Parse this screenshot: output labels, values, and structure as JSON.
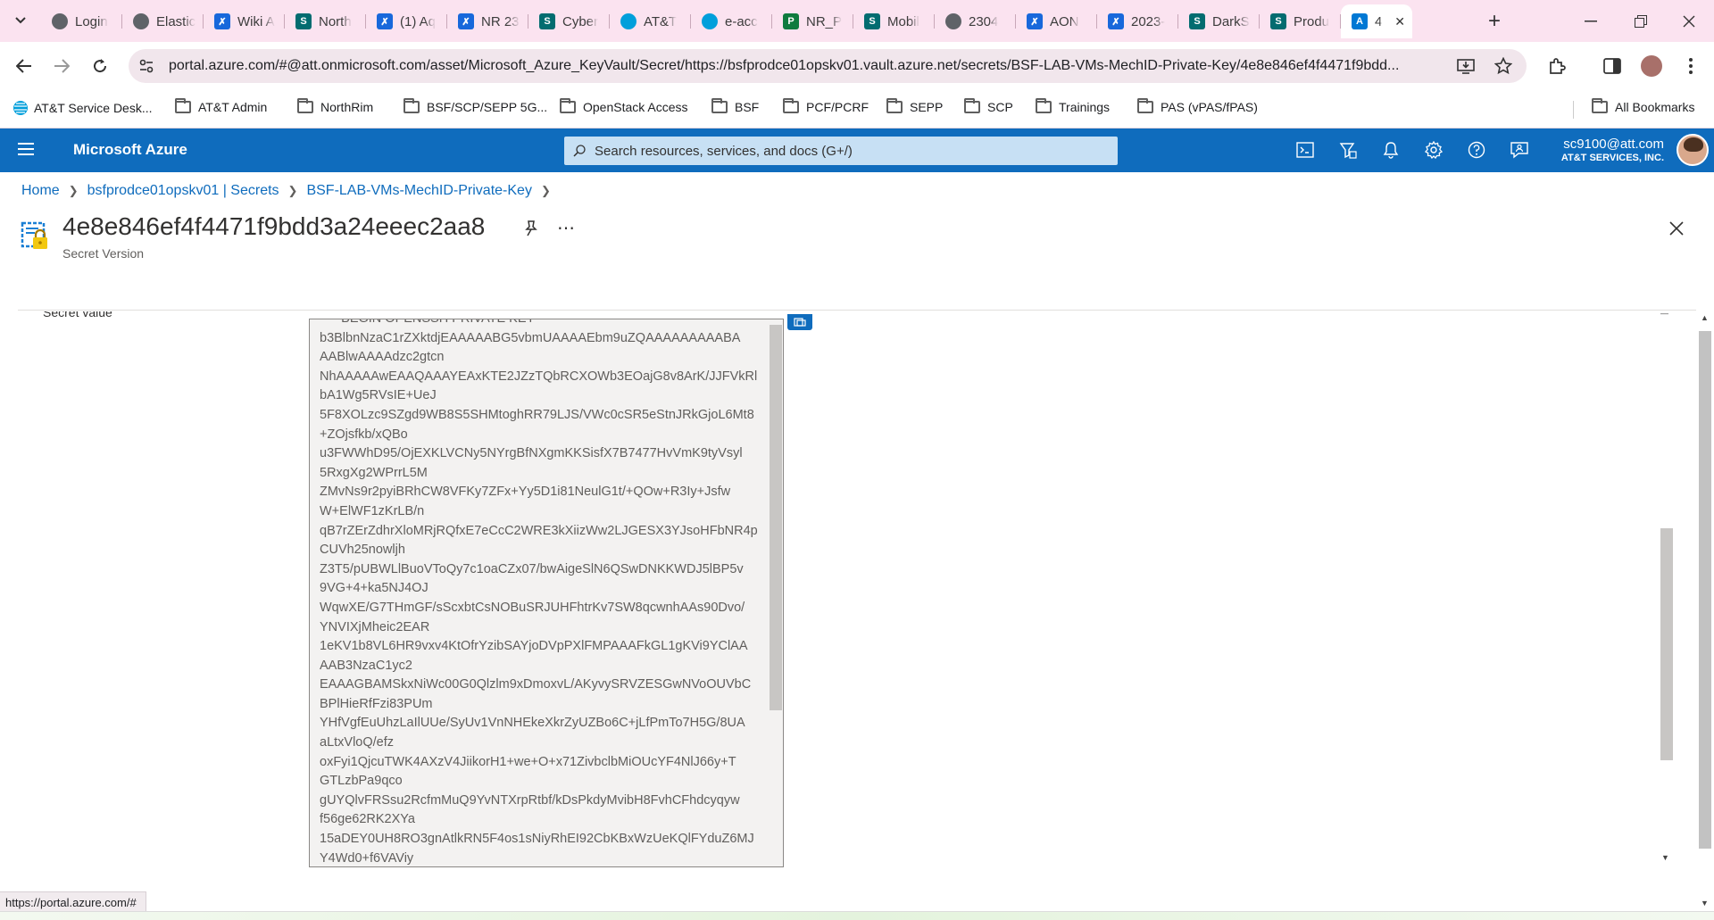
{
  "browser": {
    "tabs": [
      {
        "title": "Login",
        "favicon_color": "#5f6368",
        "favicon": "globe-icon"
      },
      {
        "title": "Elastic",
        "favicon_color": "#5f6368",
        "favicon": "elastic-icon"
      },
      {
        "title": "Wiki A",
        "favicon_color": "#1868db",
        "favicon": "confluence-icon"
      },
      {
        "title": "North",
        "favicon_color": "#036c70",
        "favicon": "sharepoint-icon"
      },
      {
        "title": "(1) Aq",
        "favicon_color": "#1868db",
        "favicon": "confluence-icon"
      },
      {
        "title": "NR 23",
        "favicon_color": "#1868db",
        "favicon": "confluence-icon"
      },
      {
        "title": "Cyber",
        "favicon_color": "#036c70",
        "favicon": "sharepoint-icon"
      },
      {
        "title": "AT&T",
        "favicon_color": "#009fdb",
        "favicon": "att-globe-icon"
      },
      {
        "title": "e-acc",
        "favicon_color": "#009fdb",
        "favicon": "att-globe-icon"
      },
      {
        "title": "NR_P",
        "favicon_color": "#0f7b3e",
        "favicon": "project-icon"
      },
      {
        "title": "Mobil",
        "favicon_color": "#036c70",
        "favicon": "sharepoint-icon"
      },
      {
        "title": "2304",
        "favicon_color": "#5f6368",
        "favicon": "globe-icon"
      },
      {
        "title": "AON",
        "favicon_color": "#1868db",
        "favicon": "confluence-icon"
      },
      {
        "title": "2023-",
        "favicon_color": "#1868db",
        "favicon": "confluence-icon"
      },
      {
        "title": "DarkS",
        "favicon_color": "#036c70",
        "favicon": "sharepoint-icon"
      },
      {
        "title": "Produ",
        "favicon_color": "#036c70",
        "favicon": "sharepoint-icon"
      },
      {
        "title": "4",
        "favicon_color": "#0078d4",
        "favicon": "azure-icon",
        "active": true
      }
    ],
    "url": "portal.azure.com/#@att.onmicrosoft.com/asset/Microsoft_Azure_KeyVault/Secret/https://bsfprodce01opskv01.vault.azure.net/secrets/BSF-LAB-VMs-MechID-Private-Key/4e8e846ef4f4471f9bdd...",
    "bookmarks": [
      "AT&T Service Desk...",
      "AT&T Admin",
      "NorthRim",
      "BSF/SCP/SEPP 5G...",
      "OpenStack Access",
      "BSF",
      "PCF/PCRF",
      "SEPP",
      "SCP",
      "Trainings",
      "PAS (vPAS/fPAS)"
    ],
    "all_bookmarks": "All Bookmarks",
    "status_url": "https://portal.azure.com/#"
  },
  "azure": {
    "brand": "Microsoft Azure",
    "search_placeholder": "Search resources, services, and docs (G+/)",
    "user_email": "sc9100@att.com",
    "user_org": "AT&T SERVICES, INC.",
    "accent": "#0f6cbd"
  },
  "breadcrumb": [
    "Home",
    "bsfprodce01opskv01 | Secrets",
    "BSF-LAB-VMs-MechID-Private-Key"
  ],
  "blade": {
    "title": "4e8e846ef4f4471f9bdd3a24eeec2aa8",
    "subtitle": "Secret Version",
    "field_label": "Secret value",
    "secret_value": "-----BEGIN OPENSSH PRIVATE KEY-----\nb3BlbnNzaC1rZXktdjEAAAAABG5vbmUAAAAEbm9uZQAAAAAAAAABA\nAABlwAAAAdzc2gtcn\nNhAAAAAwEAAQAAAYEAxKTE2JZzTQbRCXOWb3EOajG8v8ArK/JJFVkRl\nbA1Wg5RVsIE+UeJ\n5F8XOLzc9SZgd9WB8S5SHMtoghRR79LJS/VWc0cSR5eStnJRkGjoL6Mt8\n+ZOjsfkb/xQBo\nu3FWWhD95/OjEXKLVCNy5NYrgBfNXgmKKSisfX7B7477HvVmK9tyVsyl\n5RxgXg2WPrrL5M\nZMvNs9r2pyiBRhCW8VFKy7ZFx+Yy5D1i81NeulG1t/+QOw+R3Iy+Jsfw\nW+ElWF1zKrLB/n\nqB7rZErZdhrXloMRjRQfxE7eCcC2WRE3kXiizWw2LJGESX3YJsoHFbNR4p\nCUVh25nowljh\nZ3T5/pUBWLlBuoVToQy7c1oaCZx07/bwAigeSlN6QSwDNKKWDJ5lBP5v\n9VG+4+ka5NJ4OJ\nWqwXE/G7THmGF/sScxbtCsNOBuSRJUHFhtrKv7SW8qcwnhAAs90Dvo/\nYNVIXjMheic2EAR\n1eKV1b8VL6HR9vxv4KtOfrYzibSAYjoDVpPXlFMPAAAFkGL1gKVi9YClAA\nAAB3NzaC1yc2\nEAAAGBAMSkxNiWc00G0Qlzlm9xDmoxvL/AKyvySRVZESGwNVoOUVbC\nBPlHieRfFzi83PUm\nYHfVgfEuUhzLaIlUUe/SyUv1VnNHEkeXkrZyUZBo6C+jLfPmTo7H5G/8UA\naLtxVloQ/efz\noxFyi1QjcuTWK4AXzV4JiikorH1+we+O+x71ZivbclbMiOUcYF4NlJ66y+T\nGTLzbPa9qco\ngUYQlvFRSsu2RcfmMuQ9YvNTXrpRtbf/kDsPkdyMvibH8FvhCFhdcyqyw\nf56ge62RK2XYa\n15aDEY0UH8RO3gnAtlkRN5F4os1sNiyRhEI92CbKBxWzUeKQlFYduZ6MJ\nY4Wd0+f6VAViy"
  }
}
